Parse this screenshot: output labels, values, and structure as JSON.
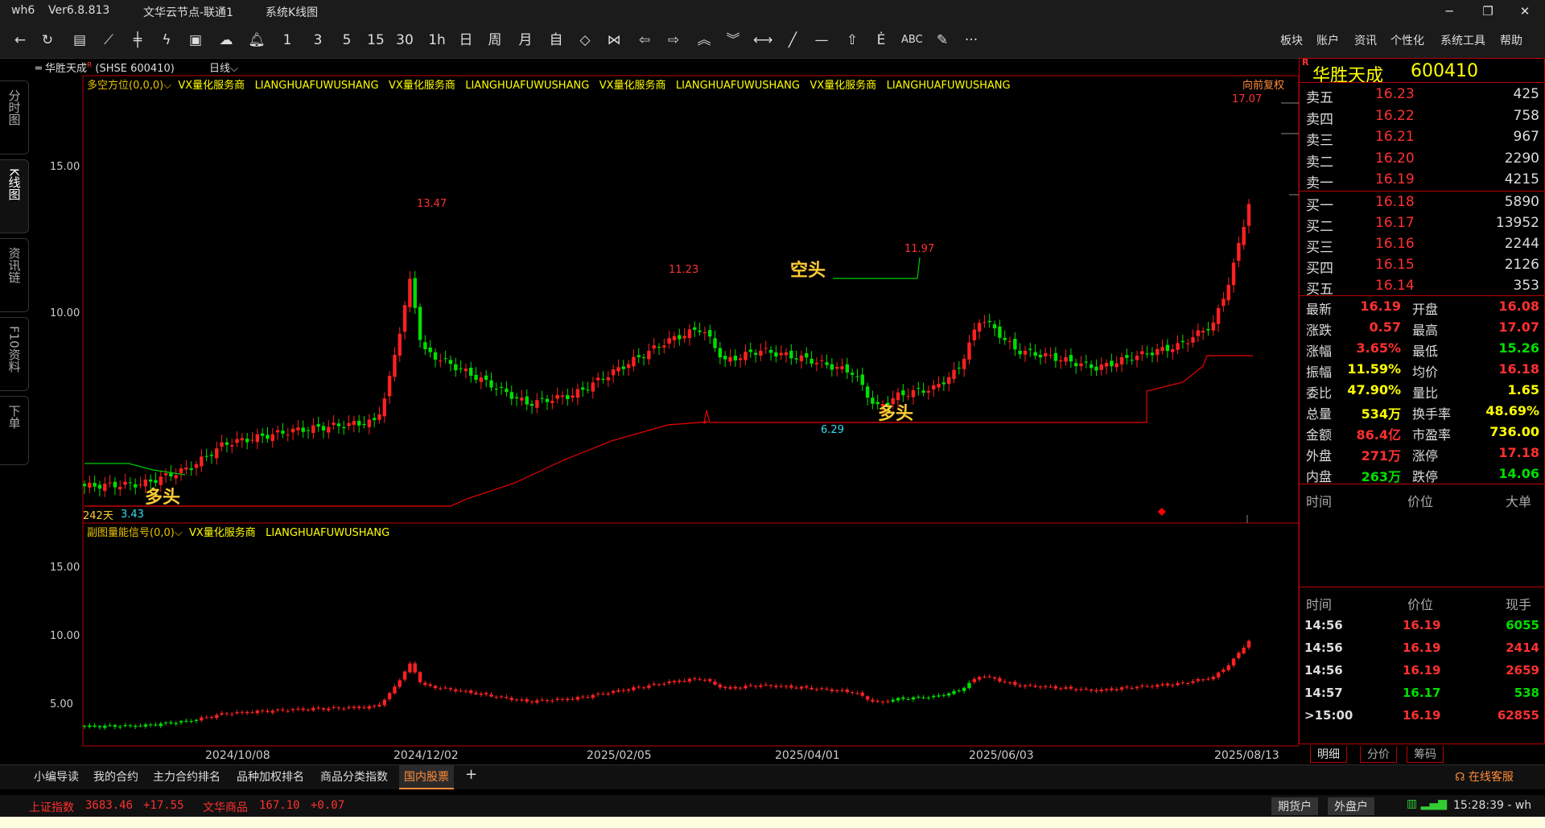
{
  "titlebar": {
    "app": "wh6",
    "version": "Ver6.8.813",
    "server": "文华云节点-联通1",
    "view": "系统K线图",
    "minimize": "─",
    "restore": "❐",
    "close": "✕"
  },
  "toolbar": {
    "icons": [
      "back-icon",
      "refresh-icon",
      "table-icon",
      "line-chart-icon",
      "kline-icon",
      "strategy-icon",
      "capture-icon",
      "cloud-icon",
      "bell-icon"
    ],
    "periods": [
      "1",
      "3",
      "5",
      "15",
      "30",
      "1h",
      "日",
      "周",
      "月",
      "自"
    ],
    "menus": [
      "板块",
      "账户",
      "资讯",
      "个性化",
      "系统工具",
      "帮助"
    ],
    "abc": "ABC",
    "more": "···"
  },
  "lefttabs": [
    "分时图",
    "K线图",
    "资讯链",
    "F10资料",
    "下单"
  ],
  "chart": {
    "symbol": "华胜天成",
    "market": "SHSE 600410",
    "period": "日线",
    "main_indicator": "多空方位(0,0,0)⌵",
    "vx": "VX量化服务商",
    "ln": "LIANGHUAFUWUSHANG",
    "fuquan": "向前复权",
    "days": "242天",
    "labels": {
      "high": "17.07",
      "p1347": "13.47",
      "p1123": "11.23",
      "p1197": "11.97",
      "p629": "6.29",
      "p343": "3.43",
      "kongtou": "空头",
      "duotou1": "多头",
      "duotou2": "多头"
    },
    "yaxis_main": [
      "15.00",
      "10.00"
    ],
    "sub_indicator": "副图量能信号(0,0)⌵",
    "yaxis_sub": [
      "15.00",
      "10.00",
      "5.00"
    ],
    "xaxis": [
      "2024/10/08",
      "2024/12/02",
      "2025/02/05",
      "2025/04/01",
      "2025/06/03",
      "2025/08/13"
    ]
  },
  "quote": {
    "title_name": "华胜天成",
    "title_code": "600410",
    "r": "R",
    "asks": [
      {
        "l": "卖五",
        "p": "16.23",
        "v": "425"
      },
      {
        "l": "卖四",
        "p": "16.22",
        "v": "758"
      },
      {
        "l": "卖三",
        "p": "16.21",
        "v": "967"
      },
      {
        "l": "卖二",
        "p": "16.20",
        "v": "2290"
      },
      {
        "l": "卖一",
        "p": "16.19",
        "v": "4215"
      }
    ],
    "bids": [
      {
        "l": "买一",
        "p": "16.18",
        "v": "5890"
      },
      {
        "l": "买二",
        "p": "16.17",
        "v": "13952"
      },
      {
        "l": "买三",
        "p": "16.16",
        "v": "2244"
      },
      {
        "l": "买四",
        "p": "16.15",
        "v": "2126"
      },
      {
        "l": "买五",
        "p": "16.14",
        "v": "353"
      }
    ],
    "stats": [
      [
        "最新",
        "16.19",
        "开盘",
        "16.08"
      ],
      [
        "涨跌",
        "0.57",
        "最高",
        "17.07"
      ],
      [
        "涨幅",
        "3.65%",
        "最低",
        "15.26"
      ],
      [
        "振幅",
        "11.59%",
        "均价",
        "16.18"
      ],
      [
        "委比",
        "47.90%",
        "量比",
        "1.65"
      ],
      [
        "总量",
        "534万",
        "换手率",
        "48.69%"
      ],
      [
        "金额",
        "86.4亿",
        "市盈率",
        "736.00"
      ],
      [
        "外盘",
        "271万",
        "涨停",
        "17.18"
      ],
      [
        "内盘",
        "263万",
        "跌停",
        "14.06"
      ]
    ],
    "hdr1": [
      "时间",
      "价位",
      "大单"
    ],
    "hdr2": [
      "时间",
      "价位",
      "现手"
    ],
    "ticks": [
      [
        "14:56",
        "16.19",
        "6055"
      ],
      [
        "14:56",
        "16.19",
        "2414"
      ],
      [
        "14:56",
        "16.19",
        "2659"
      ],
      [
        "14:57",
        "16.17",
        "538"
      ],
      [
        ">15:00",
        "16.19",
        "62855"
      ]
    ],
    "tabs": [
      "明细",
      "分价",
      "筹码"
    ]
  },
  "bottomtabs": [
    "小编导读",
    "我的合约",
    "主力合约排名",
    "品种加权排名",
    "商品分类指数",
    "国内股票",
    "+"
  ],
  "service": "在线客服",
  "status": {
    "idx1": "上证指数",
    "idx1v": "3683.46",
    "idx1c": "+17.55",
    "idx2": "文华商品",
    "idx2v": "167.10",
    "idx2c": "+0.07",
    "qh": "期货户",
    "wp": "外盘户",
    "time": "15:28:39 - wh"
  },
  "colors": {
    "up": "#ff2a2a",
    "down": "#00e000",
    "yellow": "#ffff00",
    "gold": "#ffcc33"
  }
}
